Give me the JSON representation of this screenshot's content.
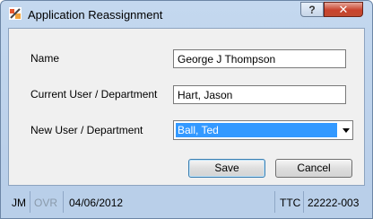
{
  "window": {
    "title": "Application Reassignment",
    "help_label": "?",
    "close_label": "✕"
  },
  "form": {
    "name_label": "Name",
    "name_value": "George J Thompson",
    "current_label": "Current User / Department",
    "current_value": "Hart, Jason",
    "new_label": "New User / Department",
    "new_value": "Ball, Ted"
  },
  "buttons": {
    "save": "Save",
    "cancel": "Cancel"
  },
  "status": {
    "user": "JM",
    "mode": "OVR",
    "date": "04/06/2012",
    "code": "TTC",
    "id": "22222-003"
  },
  "colors": {
    "selection": "#3399ff",
    "status_disabled": "#8a9aab"
  },
  "icons": [
    "app-icon",
    "help-icon",
    "close-icon",
    "chevron-down-icon"
  ]
}
